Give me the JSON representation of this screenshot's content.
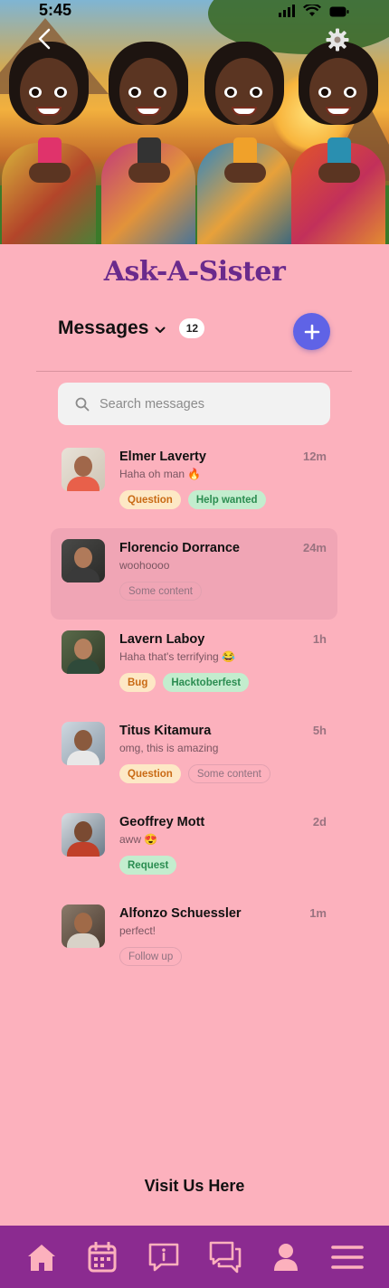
{
  "status_bar": {
    "time": "5:45"
  },
  "app": {
    "title": "Ask-A-Sister"
  },
  "messages": {
    "title": "Messages",
    "count": "12",
    "search_placeholder": "Search messages"
  },
  "colors": {
    "accent": "#5f63e6",
    "background": "#fcb1bd",
    "tabbar": "#8b2b90",
    "title": "#6a2a8c",
    "tab_icon": "#fcb1bd"
  },
  "conversations": [
    {
      "name": "Elmer Laverty",
      "time": "12m",
      "preview": "Haha oh man 🔥",
      "active": false,
      "tags": [
        {
          "label": "Question",
          "style": "orange"
        },
        {
          "label": "Help wanted",
          "style": "green"
        }
      ]
    },
    {
      "name": "Florencio Dorrance",
      "time": "24m",
      "preview": "woohoooo",
      "active": true,
      "tags": [
        {
          "label": "Some content",
          "style": "outline"
        }
      ]
    },
    {
      "name": "Lavern Laboy",
      "time": "1h",
      "preview": "Haha that's terrifying 😂",
      "active": false,
      "tags": [
        {
          "label": "Bug",
          "style": "orange"
        },
        {
          "label": "Hacktoberfest",
          "style": "green"
        }
      ]
    },
    {
      "name": "Titus Kitamura",
      "time": "5h",
      "preview": "omg, this is amazing",
      "active": false,
      "tags": [
        {
          "label": "Question",
          "style": "orange"
        },
        {
          "label": "Some content",
          "style": "outline"
        }
      ]
    },
    {
      "name": "Geoffrey Mott",
      "time": "2d",
      "preview": "aww 😍",
      "active": false,
      "tags": [
        {
          "label": "Request",
          "style": "green"
        }
      ]
    },
    {
      "name": "Alfonzo Schuessler",
      "time": "1m",
      "preview": "perfect!",
      "active": false,
      "tags": [
        {
          "label": "Follow up",
          "style": "outline"
        }
      ]
    }
  ],
  "footer": {
    "visit_label": "Visit Us Here"
  },
  "tabbar": {
    "items": [
      {
        "icon": "home-icon"
      },
      {
        "icon": "calendar-icon"
      },
      {
        "icon": "info-message-icon"
      },
      {
        "icon": "chat-icon"
      },
      {
        "icon": "profile-icon"
      },
      {
        "icon": "menu-icon"
      }
    ]
  }
}
